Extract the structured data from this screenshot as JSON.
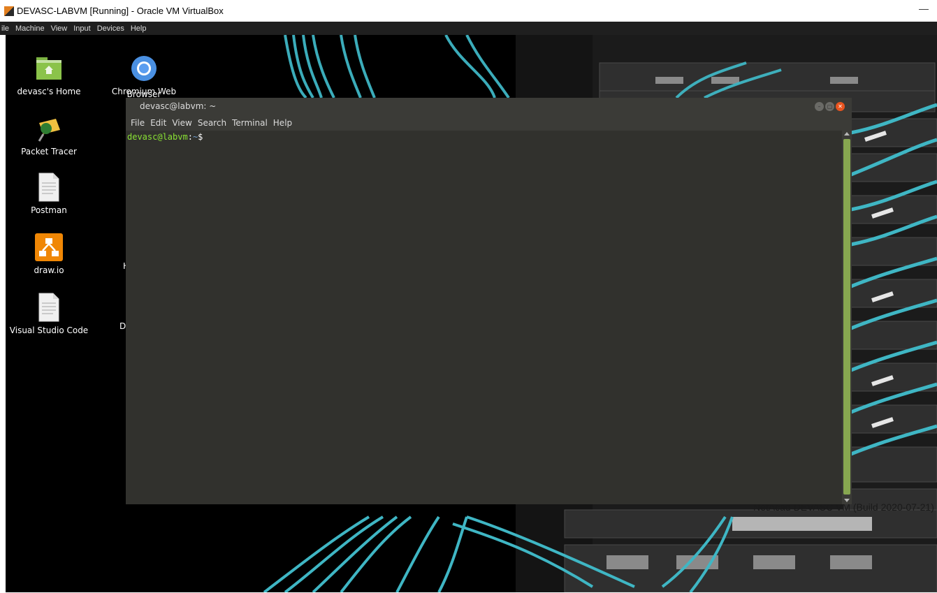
{
  "host_window": {
    "title": "DEVASC-LABVM [Running] - Oracle VM VirtualBox",
    "minimize_symbol": "—"
  },
  "vbox_menu": [
    "ile",
    "Machine",
    "View",
    "Input",
    "Devices",
    "Help"
  ],
  "desktop_icons": [
    {
      "label": "devasc's Home",
      "icon": "home-folder-icon"
    },
    {
      "label": "Chromium Web Browser",
      "icon": "chromium-icon"
    },
    {
      "label": "Packet Tracer",
      "icon": "packet-tracer-icon"
    },
    {
      "label": "Postman",
      "icon": "document-icon"
    },
    {
      "label": "draw.io",
      "icon": "drawio-icon"
    },
    {
      "label": "Visual Studio Code",
      "icon": "document-icon"
    }
  ],
  "partial_labels": [
    "Browser",
    "H",
    "Di"
  ],
  "build_label": "NetAcad DEVASC VM (Build 2020-07-21)",
  "terminal": {
    "title": "devasc@labvm: ~",
    "menu": [
      "File",
      "Edit",
      "View",
      "Search",
      "Terminal",
      "Help"
    ],
    "prompt_user": "devasc@labvm",
    "prompt_sep": ":",
    "prompt_path": "~",
    "prompt_symbol": "$"
  },
  "colors": {
    "terminal_bg": "#31312d",
    "prompt_user": "#8ae234",
    "prompt_path": "#729fcf",
    "scrollbar_thumb": "#87a750",
    "close_button": "#e9541f",
    "cable_accent": "#3fb6c4"
  }
}
